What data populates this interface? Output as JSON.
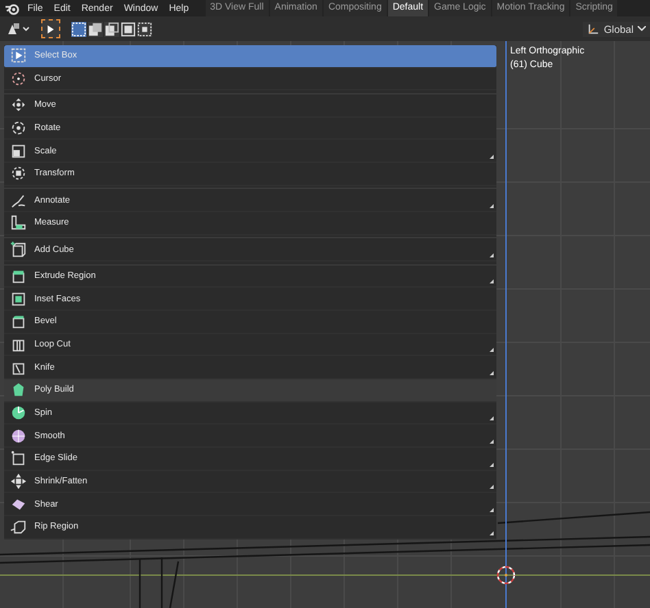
{
  "menu_bar": {
    "items": [
      "File",
      "Edit",
      "Render",
      "Window",
      "Help"
    ]
  },
  "workspace_tabs": [
    {
      "label": "3D View Full",
      "selected": false
    },
    {
      "label": "Animation",
      "selected": false
    },
    {
      "label": "Compositing",
      "selected": false
    },
    {
      "label": "Default",
      "selected": true
    },
    {
      "label": "Game Logic",
      "selected": false
    },
    {
      "label": "Motion Tracking",
      "selected": false
    },
    {
      "label": "Scripting",
      "selected": false
    }
  ],
  "header": {
    "select_modes": [
      {
        "selected": true
      },
      {
        "selected": false
      },
      {
        "selected": false
      },
      {
        "selected": false
      },
      {
        "selected": false
      }
    ],
    "orientation": "Global"
  },
  "viewport": {
    "view_name": "Left Orthographic",
    "object_label": "(61) Cube"
  },
  "tool_menu": {
    "groups": [
      {
        "items": [
          {
            "label": "Select Box",
            "selected": true,
            "hovered": false,
            "has_variants": false
          },
          {
            "label": "Cursor",
            "selected": false,
            "hovered": false,
            "has_variants": false
          }
        ]
      },
      {
        "items": [
          {
            "label": "Move",
            "selected": false,
            "hovered": false,
            "has_variants": false
          },
          {
            "label": "Rotate",
            "selected": false,
            "hovered": false,
            "has_variants": false
          },
          {
            "label": "Scale",
            "selected": false,
            "hovered": false,
            "has_variants": true
          },
          {
            "label": "Transform",
            "selected": false,
            "hovered": false,
            "has_variants": false
          }
        ]
      },
      {
        "items": [
          {
            "label": "Annotate",
            "selected": false,
            "hovered": false,
            "has_variants": true
          },
          {
            "label": "Measure",
            "selected": false,
            "hovered": false,
            "has_variants": false
          }
        ]
      },
      {
        "items": [
          {
            "label": "Add Cube",
            "selected": false,
            "hovered": false,
            "has_variants": true
          }
        ]
      },
      {
        "items": [
          {
            "label": "Extrude Region",
            "selected": false,
            "hovered": false,
            "has_variants": true
          },
          {
            "label": "Inset Faces",
            "selected": false,
            "hovered": false,
            "has_variants": false
          },
          {
            "label": "Bevel",
            "selected": false,
            "hovered": false,
            "has_variants": false
          },
          {
            "label": "Loop Cut",
            "selected": false,
            "hovered": false,
            "has_variants": true
          },
          {
            "label": "Knife",
            "selected": false,
            "hovered": false,
            "has_variants": true
          },
          {
            "label": "Poly Build",
            "selected": false,
            "hovered": true,
            "has_variants": false
          },
          {
            "label": "Spin",
            "selected": false,
            "hovered": false,
            "has_variants": true
          },
          {
            "label": "Smooth",
            "selected": false,
            "hovered": false,
            "has_variants": true
          },
          {
            "label": "Edge Slide",
            "selected": false,
            "hovered": false,
            "has_variants": true
          },
          {
            "label": "Shrink/Fatten",
            "selected": false,
            "hovered": false,
            "has_variants": true
          },
          {
            "label": "Shear",
            "selected": false,
            "hovered": false,
            "has_variants": true
          },
          {
            "label": "Rip Region",
            "selected": false,
            "hovered": false,
            "has_variants": true
          }
        ]
      }
    ]
  }
}
